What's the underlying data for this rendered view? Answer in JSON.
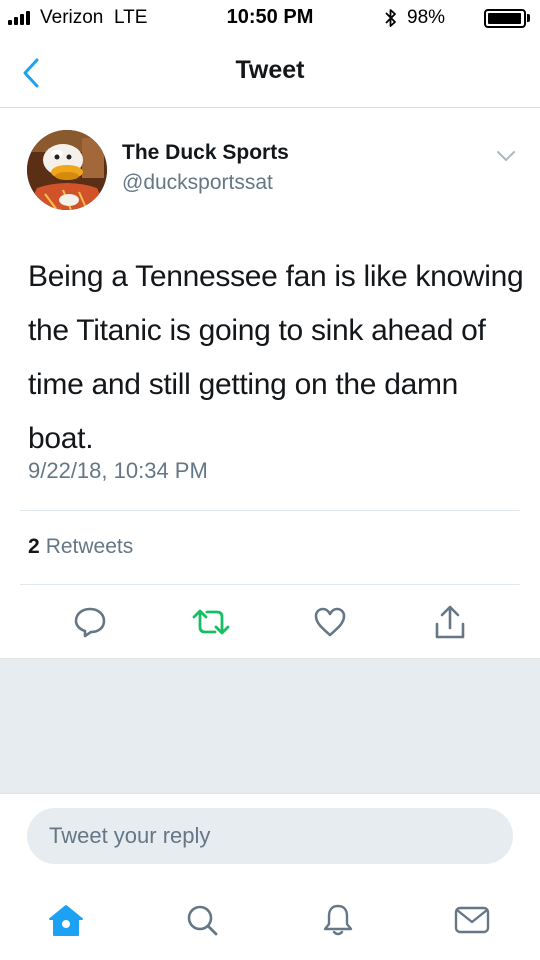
{
  "status_bar": {
    "carrier": "Verizon",
    "network": "LTE",
    "time": "10:50 PM",
    "battery": "98%",
    "battery_level": 0.98
  },
  "header": {
    "title": "Tweet",
    "back_icon": "chevron-left-icon"
  },
  "tweet": {
    "display_name": "The Duck Sports",
    "handle": "@ducksportssat",
    "text": "Being a Tennessee fan is like knowing the Titanic is going to sink ahead of time and still getting on the damn boat.",
    "timestamp": "9/22/18, 10:34 PM",
    "retweet_count": "2",
    "retweet_label": "Retweets"
  },
  "actions": [
    {
      "name": "reply",
      "icon": "reply-icon"
    },
    {
      "name": "retweet",
      "icon": "retweet-icon",
      "color": "#17bf63"
    },
    {
      "name": "like",
      "icon": "heart-icon"
    },
    {
      "name": "share",
      "icon": "share-icon"
    }
  ],
  "reply": {
    "placeholder": "Tweet your reply"
  },
  "tabbar": [
    {
      "name": "home",
      "icon": "home-icon",
      "active": true
    },
    {
      "name": "search",
      "icon": "search-icon"
    },
    {
      "name": "notifications",
      "icon": "bell-icon"
    },
    {
      "name": "messages",
      "icon": "mail-icon"
    }
  ],
  "colors": {
    "accent": "#1da1f2",
    "retweet": "#17bf63",
    "secondary_text": "#657786",
    "primary_text": "#14171a"
  }
}
